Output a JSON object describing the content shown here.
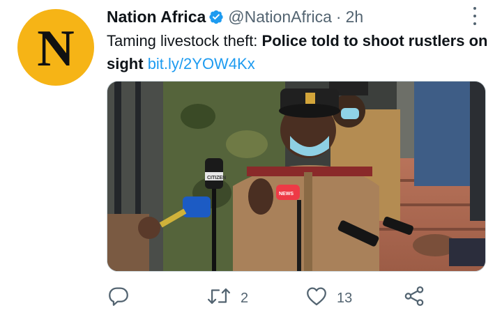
{
  "account": {
    "name": "Nation Africa",
    "handle": "@NationAfrica",
    "separator": "·",
    "time": "2h",
    "avatar_letter": "N",
    "avatar_color": "#f6b416",
    "verified_icon": "verified-badge-icon",
    "verified_color": "#1d9bf0"
  },
  "tweet": {
    "text_plain": "Taming livestock theft: ",
    "text_bold": "Police told to shoot rustlers on sight",
    "link": "bit.ly/2YOW4Kx",
    "link_color": "#1d9bf0"
  },
  "media": {
    "microphone_labels": [
      "CITIZEN",
      "NEWS"
    ]
  },
  "actions": {
    "reply": {
      "icon": "reply-icon",
      "count": ""
    },
    "retweet": {
      "icon": "retweet-icon",
      "count": "2"
    },
    "like": {
      "icon": "heart-icon",
      "count": "13"
    },
    "share": {
      "icon": "share-icon",
      "count": ""
    }
  },
  "menu_icon": "more-vertical-icon"
}
